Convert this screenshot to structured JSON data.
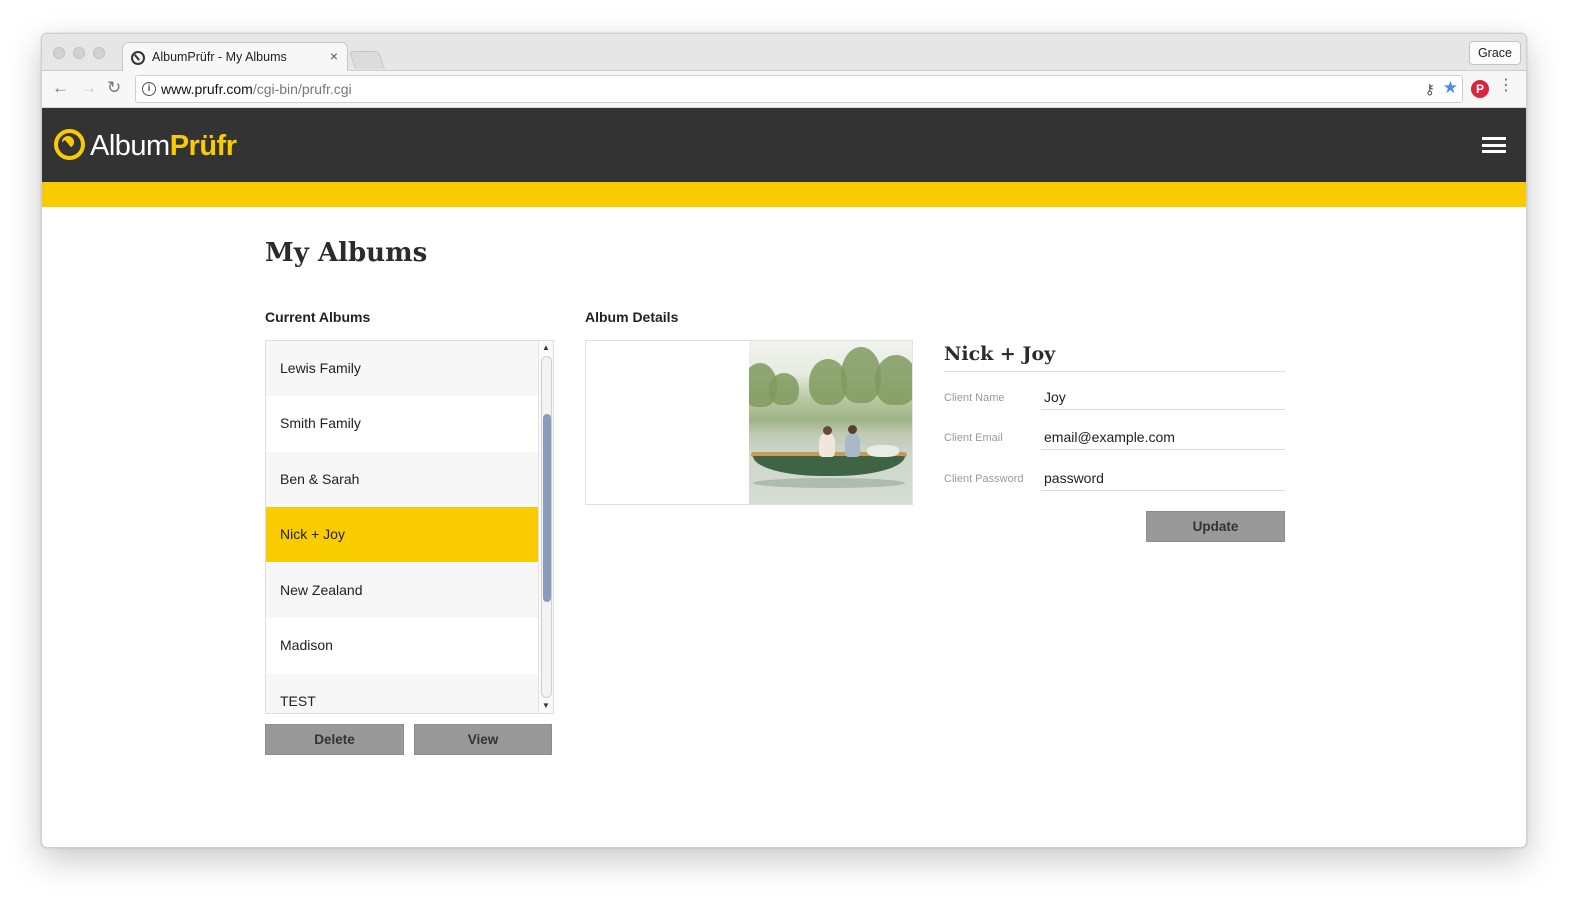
{
  "browser": {
    "tab_title": "AlbumPrüfr - My Albums",
    "tab_close": "×",
    "profile_name": "Grace",
    "url_host": "www.prufr.com",
    "url_path": "/cgi-bin/prufr.cgi",
    "icons": [
      "back-arrow-icon",
      "forward-arrow-icon",
      "reload-icon",
      "info-icon",
      "key-icon",
      "star-icon",
      "pinterest-icon",
      "menu-dots-icon"
    ]
  },
  "header": {
    "logo_album": "Album",
    "logo_prufr": "Prüfr",
    "accent_color": "#f9cc00",
    "bar_color": "#333333"
  },
  "page": {
    "title": "My Albums",
    "current_albums_label": "Current Albums",
    "album_details_label": "Album Details"
  },
  "albums": {
    "items": [
      "Lewis Family",
      "Smith Family",
      "Ben & Sarah",
      "Nick + Joy",
      "New Zealand",
      "Madison",
      "TEST"
    ],
    "selected": "Nick + Joy"
  },
  "buttons": {
    "delete": "Delete",
    "view": "View",
    "update": "Update"
  },
  "details": {
    "name": "Nick + Joy",
    "client_name_label": "Client Name",
    "client_name_value": "Joy",
    "client_email_label": "Client Email",
    "client_email_value": "email@example.com",
    "client_password_label": "Client Password",
    "client_password_value": "password"
  }
}
